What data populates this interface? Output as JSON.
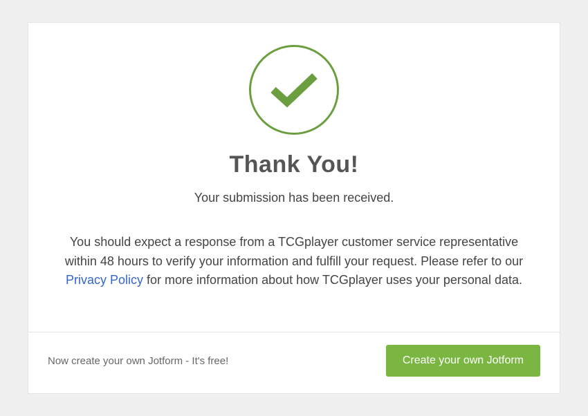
{
  "main": {
    "heading": "Thank You!",
    "subheading": "Your submission has been received.",
    "body_before_link": "You should expect a response from a TCGplayer customer service representative within 48 hours to verify your information and fulfill your request. Please refer to our ",
    "link_text": "Privacy Policy",
    "body_after_link": " for more information about how TCGplayer uses your personal data."
  },
  "footer": {
    "prompt": "Now create your own Jotform - It's free!",
    "cta_label": "Create your own Jotform"
  },
  "colors": {
    "accent_green": "#6b9e3f",
    "button_green": "#7bb642",
    "link_blue": "#3366cc"
  }
}
